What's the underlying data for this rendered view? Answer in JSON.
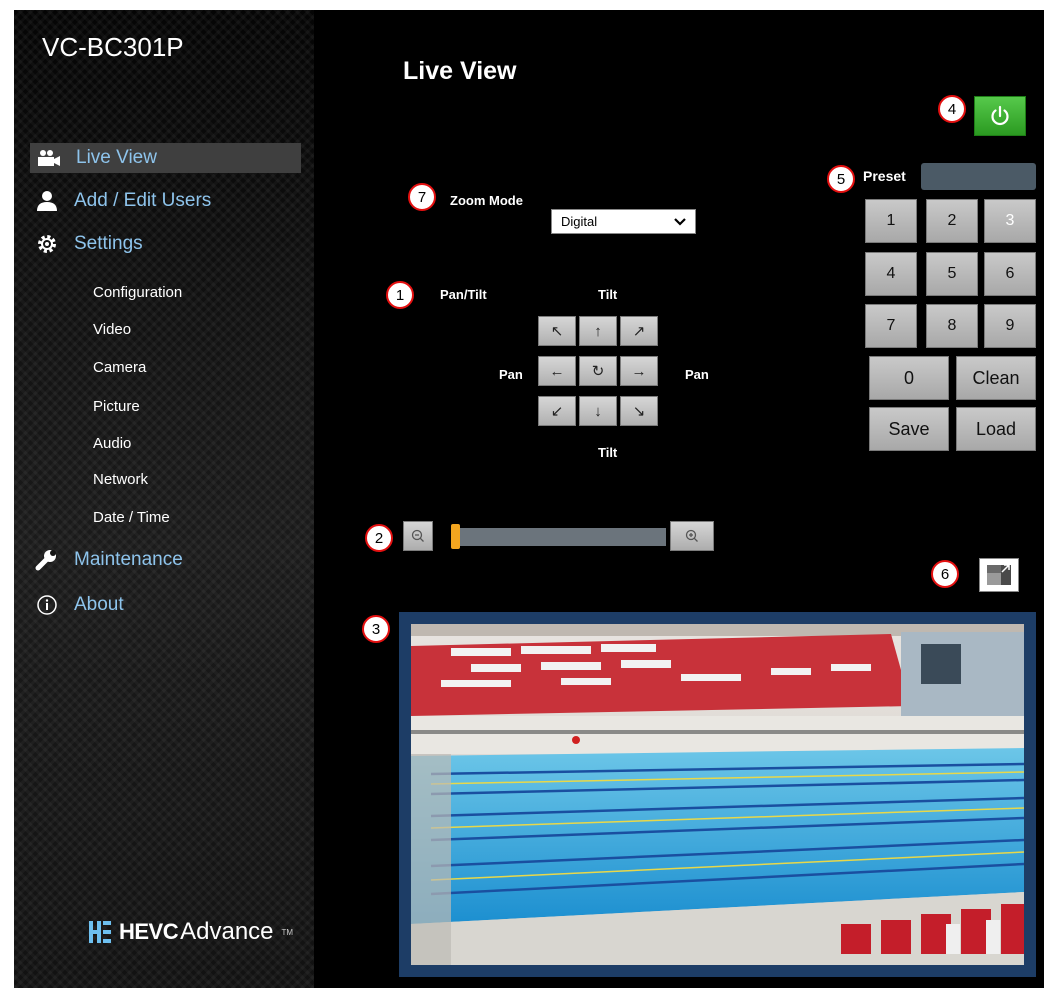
{
  "sidebar": {
    "model": "VC-BC301P",
    "nav": [
      {
        "label": "Live View",
        "icon": "video-camera-icon",
        "active": true
      },
      {
        "label": "Add / Edit Users",
        "icon": "user-icon"
      },
      {
        "label": "Settings",
        "icon": "gear-icon"
      }
    ],
    "settings_items": [
      "Configuration",
      "Video",
      "Camera",
      "Picture",
      "Audio",
      "Network",
      "Date / Time"
    ],
    "nav_bottom": [
      {
        "label": "Maintenance",
        "icon": "wrench-icon"
      },
      {
        "label": "About",
        "icon": "info-icon"
      }
    ],
    "logo": {
      "hevc": "HEVC",
      "advance": "Advance",
      "tm": "TM"
    }
  },
  "main": {
    "title": "Live View",
    "callouts": [
      "1",
      "2",
      "3",
      "4",
      "5",
      "6",
      "7"
    ],
    "zoom_mode": {
      "label": "Zoom Mode",
      "selected": "Digital"
    },
    "pan_tilt": {
      "label": "Pan/Tilt",
      "tilt_top": "Tilt",
      "tilt_bottom": "Tilt",
      "pan_left": "Pan",
      "pan_right": "Pan",
      "arrows": [
        "↖",
        "↑",
        "↗",
        "←",
        "↻",
        "→",
        "↙",
        "↓",
        "↘"
      ]
    },
    "zoom_slider": {
      "level": 0.0
    },
    "preset": {
      "label": "Preset",
      "value": "",
      "keys": [
        "1",
        "2",
        "3",
        "4",
        "5",
        "6",
        "7",
        "8",
        "9"
      ],
      "zero": "0",
      "clean": "Clean",
      "save": "Save",
      "load": "Load"
    }
  },
  "colors": {
    "accent_link": "#8ec4ec",
    "power_green": "#3cb231",
    "callout_red": "#e41010",
    "slider_thumb": "#f3a51f"
  }
}
